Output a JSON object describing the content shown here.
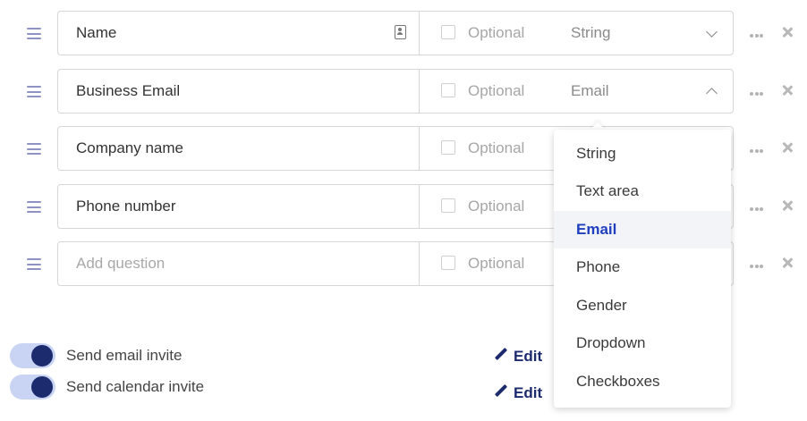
{
  "questions": [
    {
      "label": "Name",
      "placeholder": false,
      "optional": "Optional",
      "type": "String",
      "open": false,
      "icon": "contact-card-icon"
    },
    {
      "label": "Business Email",
      "placeholder": false,
      "optional": "Optional",
      "type": "Email",
      "open": true
    },
    {
      "label": "Company name",
      "placeholder": false,
      "optional": "Optional",
      "type": "",
      "open": false
    },
    {
      "label": "Phone number",
      "placeholder": false,
      "optional": "Optional",
      "type": "",
      "open": false
    },
    {
      "label": "Add question",
      "placeholder": true,
      "optional": "Optional",
      "type": "",
      "open": false
    }
  ],
  "type_dropdown": {
    "options": [
      "String",
      "Text area",
      "Email",
      "Phone",
      "Gender",
      "Dropdown",
      "Checkboxes"
    ],
    "selected": "Email"
  },
  "toggles": [
    {
      "label": "Send email invite",
      "on": true,
      "edit_label": "Edit"
    },
    {
      "label": "Send calendar invite",
      "on": true,
      "edit_label": "Edit"
    }
  ],
  "colors": {
    "accent": "#1c2a6e",
    "toggle_track": "#c9d4f4",
    "selected_option": "#1f3fbf",
    "drag_handle": "#8f93c4"
  }
}
